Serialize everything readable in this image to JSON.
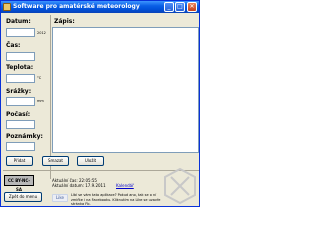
{
  "window": {
    "title": "Software pro amatérské meteorology",
    "minimize": "_",
    "maximize": "□",
    "close": "✕"
  },
  "form": {
    "datum_label": "Datum:",
    "datum_suffix": "2012",
    "cas_label": "Čas:",
    "teplota_label": "Teplota:",
    "teplota_unit": "°C",
    "srazky_label": "Srážky:",
    "srazky_unit": "mm",
    "pocasi_label": "Počasí:",
    "poznamky_label": "Poznámky:"
  },
  "notes": {
    "label": "Zápis:"
  },
  "buttons": {
    "pridat": "Přidat",
    "smazat": "Smazat",
    "ulozit": "Uložit"
  },
  "footer": {
    "license_badge": "CC BY-NC-SA",
    "back_button": "Zpět do menu",
    "current_version": "Aktuální čas:",
    "current_version_value": "22:05:55",
    "current_date": "Aktuální datum:",
    "current_date_value": "17.9.2011",
    "contact_link": "Kalendář",
    "like_button": "Like",
    "facebook_text": "Líbí se vám tato aplikace? Pokud ano, tak se o ní zmiňte i na Facebooku. Kliknutím na Like se uzavře stránka Fb."
  },
  "colors": {
    "titlebar": "#0a5fe6",
    "window_bg": "#ece9d8",
    "link": "#0000cc"
  }
}
